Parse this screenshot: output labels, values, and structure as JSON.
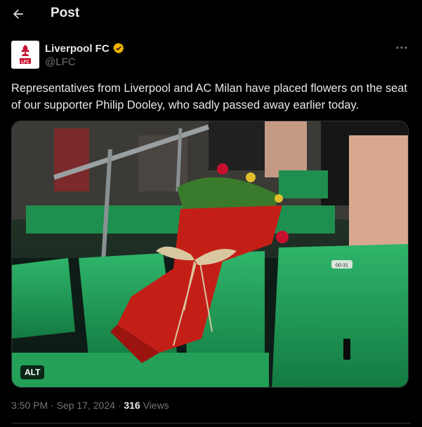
{
  "header": {
    "title": "Post",
    "back_icon": "arrow-left-icon"
  },
  "author": {
    "name": "Liverpool FC",
    "handle": "@LFC",
    "avatar_text": "LFC",
    "verified_icon": "verified-badge-icon",
    "verified_color": "#f4b400"
  },
  "more_icon": "more-horizontal-icon",
  "post": {
    "text": "Representatives from Liverpool and AC Milan have placed flowers on the seat of our supporter Philip Dooley, who sadly passed away earlier today."
  },
  "media": {
    "alt_label": "ALT",
    "seat_tag": "00-31"
  },
  "meta": {
    "time": "3:50 PM",
    "separator1": " · ",
    "date": "Sep 17, 2024",
    "separator2": " · ",
    "views_count": "316",
    "views_label": " Views"
  },
  "colors": {
    "background": "#000000",
    "text": "#e7e9ea",
    "muted": "#71767b",
    "lfc_red": "#c8102e"
  }
}
